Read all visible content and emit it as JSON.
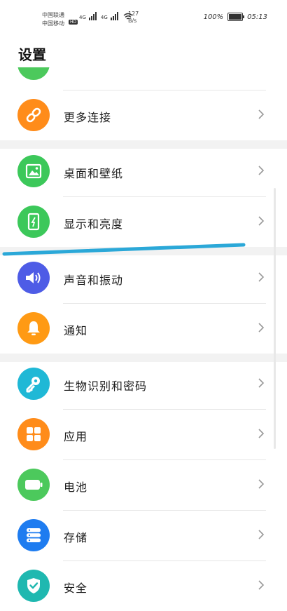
{
  "status_bar": {
    "carrier_1": "中国联通",
    "carrier_2": "中国移动",
    "hd_badge": "HD",
    "net_1": "4G",
    "net_2": "4G",
    "speed_value": "127",
    "speed_unit": "B/s",
    "battery_percent": "100%",
    "time": "05:13"
  },
  "header": {
    "title": "设置"
  },
  "settings": {
    "items": [
      {
        "label": "更多连接",
        "icon": "link-icon",
        "color": "#ff8c1a"
      },
      {
        "label": "桌面和壁纸",
        "icon": "image-icon",
        "color": "#3cc85a"
      },
      {
        "label": "显示和亮度",
        "icon": "phone-brightness-icon",
        "color": "#3cc85a"
      },
      {
        "label": "声音和振动",
        "icon": "speaker-icon",
        "color": "#4e5ce6"
      },
      {
        "label": "通知",
        "icon": "bell-icon",
        "color": "#ff9a14"
      },
      {
        "label": "生物识别和密码",
        "icon": "key-icon",
        "color": "#1fb8d6"
      },
      {
        "label": "应用",
        "icon": "apps-grid-icon",
        "color": "#ff8c1a"
      },
      {
        "label": "电池",
        "icon": "battery-icon",
        "color": "#4cc95c"
      },
      {
        "label": "存储",
        "icon": "storage-icon",
        "color": "#1e7cf0"
      },
      {
        "label": "安全",
        "icon": "shield-icon",
        "color": "#1fb8b0"
      }
    ]
  },
  "colors": {
    "annotation_stroke": "#2ba8d8",
    "partial_icon": "#4cc95c"
  }
}
